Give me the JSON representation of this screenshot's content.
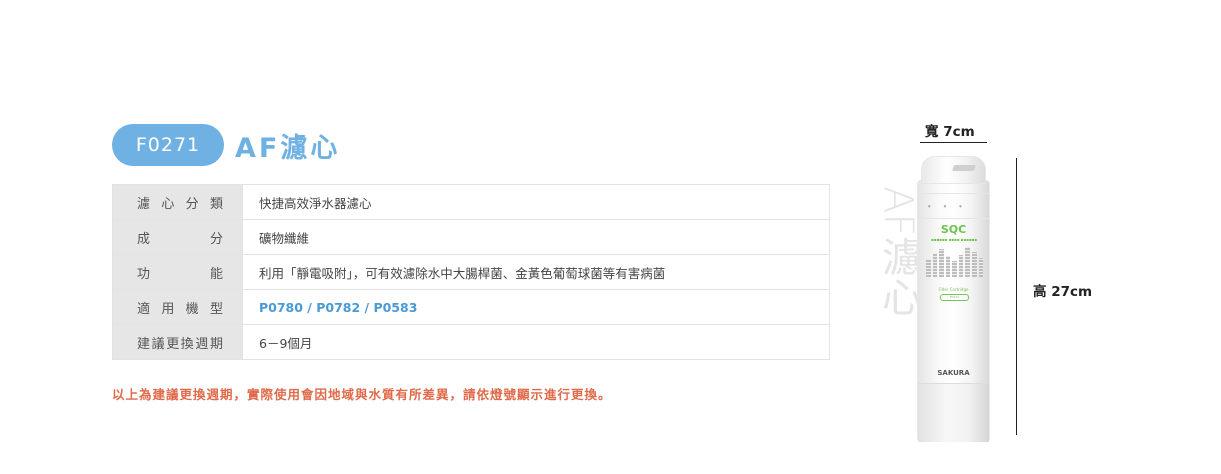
{
  "header": {
    "model_code": "F0271",
    "title": "AF濾心"
  },
  "spec_rows": [
    {
      "label": "濾心分類",
      "value": "快捷高效淨水器濾心",
      "highlight": false
    },
    {
      "label": "成分",
      "value": "礦物纖維",
      "highlight": false
    },
    {
      "label": "功能",
      "value": "利用「靜電吸附」，可有效濾除水中大腸桿菌、金黃色葡萄球菌等有害病菌",
      "highlight": false
    },
    {
      "label": "適用機型",
      "value": "P0780 / P0782 / P0583",
      "highlight": true
    },
    {
      "label": "建議更換週期",
      "value": "6－9個月",
      "highlight": false
    }
  ],
  "note": "以上為建議更換週期，實際使用會因地域與水質有所差異，請依燈號顯示進行更換。",
  "product": {
    "vertical_text": "AF濾心",
    "width_label": "寬 7cm",
    "height_label": "高 27cm",
    "cartridge_brand": "SQC",
    "cartridge_label": "Filter Cartridge",
    "cartridge_code": "F0271",
    "cartridge_maker": "SAKURA"
  },
  "colors": {
    "accent": "#6fb1e3",
    "note": "#e06a4a",
    "label_bg": "#e6e6e6",
    "brand_green": "#6cc24a"
  }
}
